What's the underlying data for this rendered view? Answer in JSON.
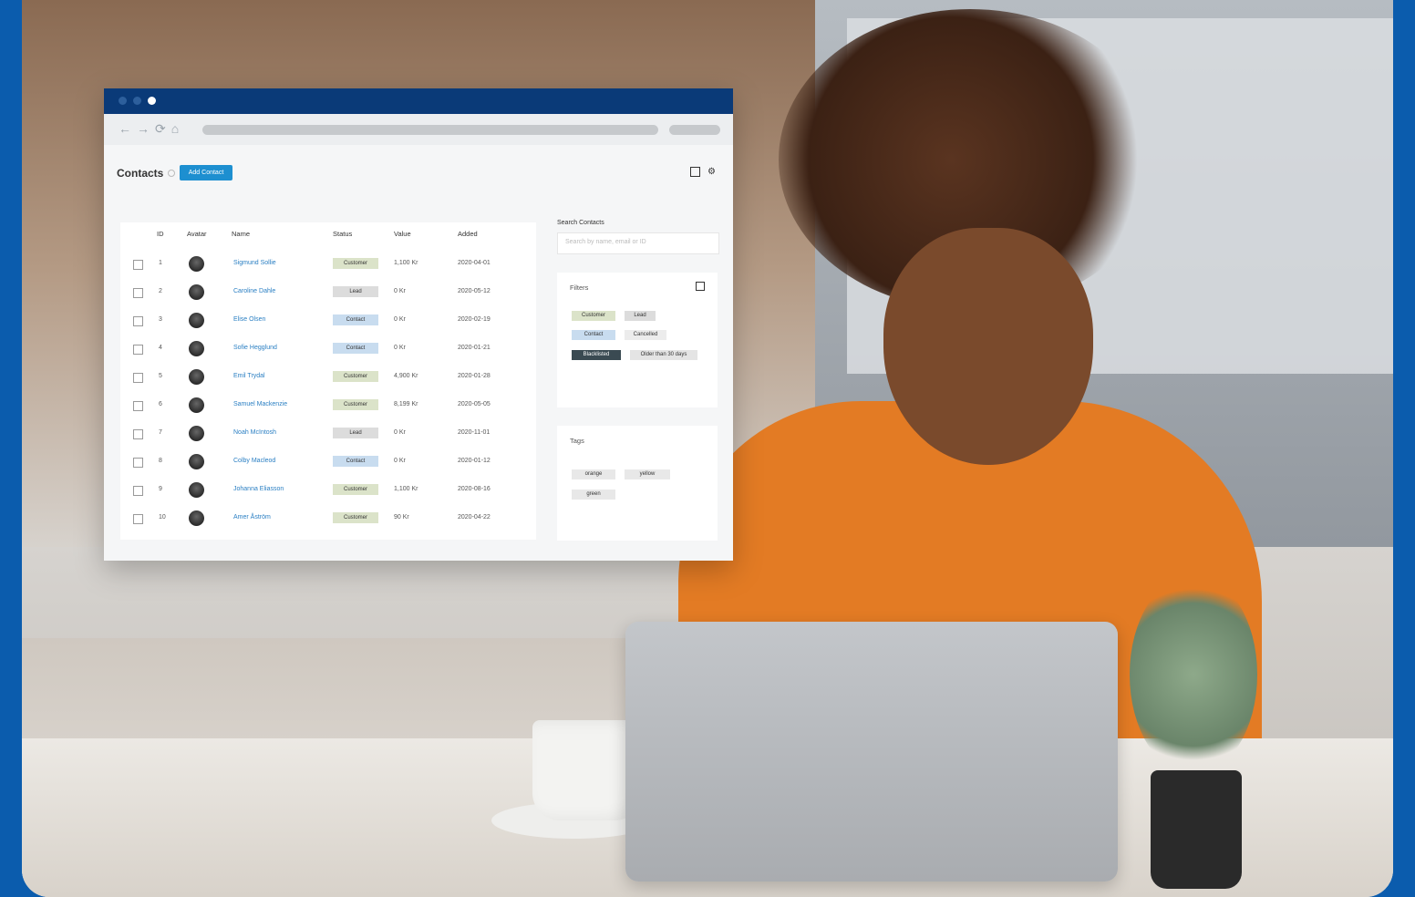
{
  "app": {
    "page_title": "Contacts",
    "add_button": "Add Contact"
  },
  "table": {
    "headers": [
      "ID",
      "Avatar",
      "Name",
      "Status",
      "Value",
      "Added"
    ],
    "rows": [
      {
        "id": "1",
        "name": "Sigmund Sollie",
        "status": "Customer",
        "value": "1,100 Kr",
        "added": "2020-04-01"
      },
      {
        "id": "2",
        "name": "Caroline Dahle",
        "status": "Lead",
        "value": "0 Kr",
        "added": "2020-05-12"
      },
      {
        "id": "3",
        "name": "Elise Olsen",
        "status": "Contact",
        "value": "0 Kr",
        "added": "2020-02-19"
      },
      {
        "id": "4",
        "name": "Sofie Hegglund",
        "status": "Contact",
        "value": "0 Kr",
        "added": "2020-01-21"
      },
      {
        "id": "5",
        "name": "Emil Trydal",
        "status": "Customer",
        "value": "4,900 Kr",
        "added": "2020-01-28"
      },
      {
        "id": "6",
        "name": "Samuel Mackenzie",
        "status": "Customer",
        "value": "8,199 Kr",
        "added": "2020-05-05"
      },
      {
        "id": "7",
        "name": "Noah McIntosh",
        "status": "Lead",
        "value": "0 Kr",
        "added": "2020-11-01"
      },
      {
        "id": "8",
        "name": "Colby Macleod",
        "status": "Contact",
        "value": "0 Kr",
        "added": "2020-01-12"
      },
      {
        "id": "9",
        "name": "Johanna Eliasson",
        "status": "Customer",
        "value": "1,100 Kr",
        "added": "2020-08-16"
      },
      {
        "id": "10",
        "name": "Amer Åström",
        "status": "Customer",
        "value": "90 Kr",
        "added": "2020-04-22"
      }
    ]
  },
  "search": {
    "label": "Search Contacts",
    "placeholder": "Search by name, email or ID"
  },
  "filters": {
    "title": "Filters",
    "chips": [
      "Customer",
      "Lead",
      "Contact",
      "Cancelled",
      "Blacklisted",
      "Older than 30 days"
    ]
  },
  "tags": {
    "title": "Tags",
    "chips": [
      "orange",
      "yellow",
      "green"
    ]
  },
  "colors": {
    "frame_border": "#0b5cad",
    "titlebar": "#0a3a78",
    "accent_button": "#1d8fd0",
    "link": "#2a7fc3",
    "status_customer": "#dbe3c9",
    "status_lead": "#dcdcdc",
    "status_contact": "#c8dcef"
  }
}
